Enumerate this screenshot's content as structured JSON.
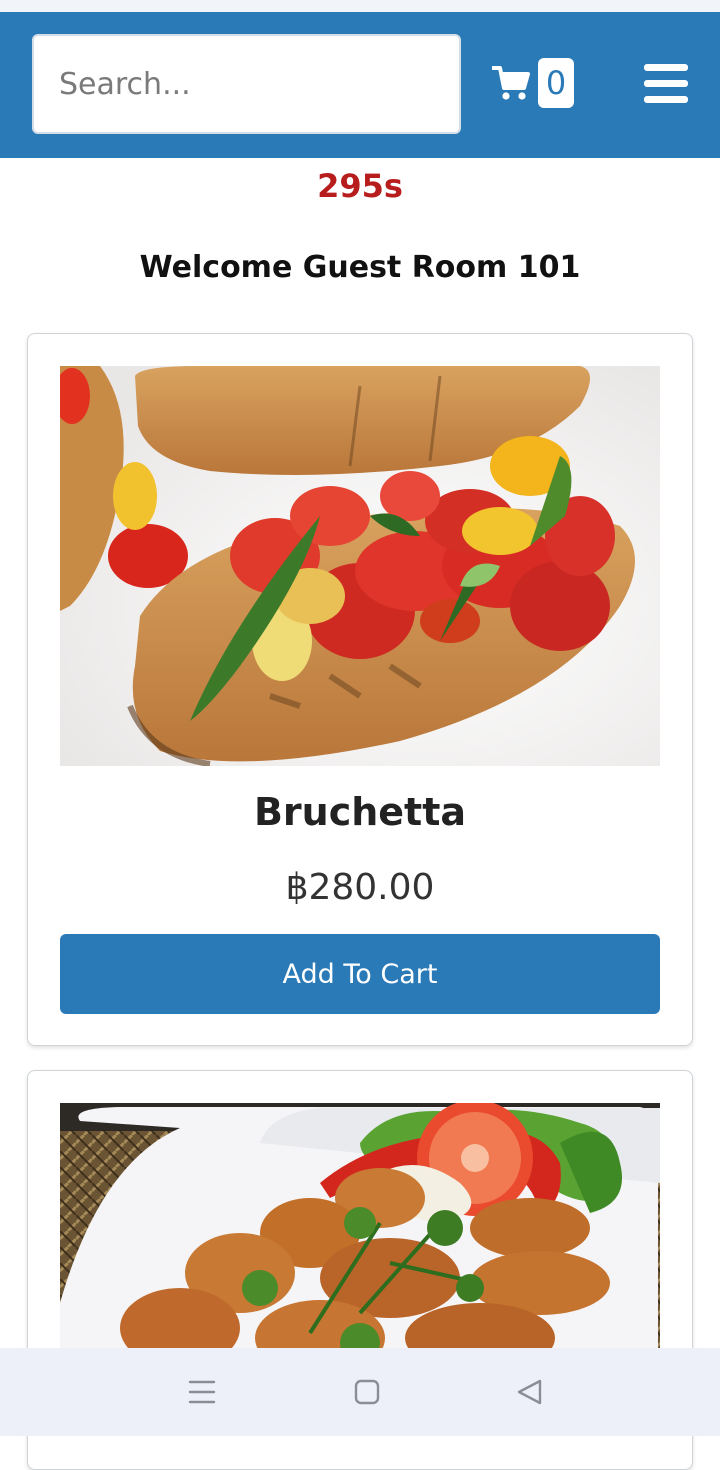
{
  "search": {
    "placeholder": "Search...",
    "value": ""
  },
  "cart": {
    "count": "0",
    "icon": "cart-icon"
  },
  "menu": {
    "icon": "hamburger-menu-icon"
  },
  "timer": "295s",
  "welcome": "Welcome Guest Room 101",
  "colors": {
    "brand": "#2a7ab7",
    "timer": "#b81d1d",
    "nav_bg": "#eef0f9"
  },
  "products": [
    {
      "name": "Bruchetta",
      "price": "฿280.00",
      "button_label": "Add To Cart",
      "image": "bruschetta-photo"
    },
    {
      "image": "fried-chicken-wings-photo"
    }
  ],
  "system_nav": [
    {
      "icon": "recents-icon"
    },
    {
      "icon": "home-icon"
    },
    {
      "icon": "back-icon"
    }
  ]
}
